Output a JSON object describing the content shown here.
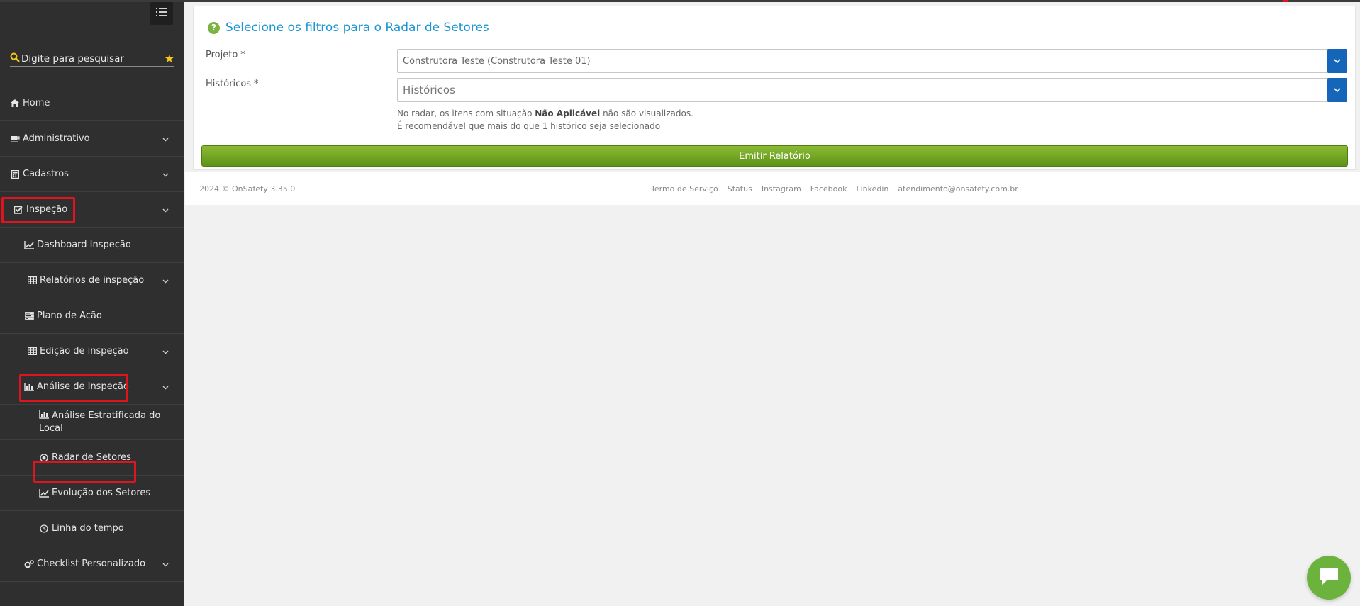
{
  "sidebar": {
    "search_placeholder": "Digite para pesquisar",
    "items": [
      {
        "label": "Home",
        "icon": "home-icon"
      },
      {
        "label": "Administrativo",
        "icon": "coffee-icon"
      },
      {
        "label": "Cadastros",
        "icon": "calculator-icon"
      },
      {
        "label": "Inspeção",
        "icon": "checkbox-icon"
      },
      {
        "label": "Dashboard Inspeção",
        "icon": "line-chart-icon"
      },
      {
        "label": "Relatórios de inspeção",
        "icon": "table-icon"
      },
      {
        "label": "Plano de Ação",
        "icon": "tasks-icon"
      },
      {
        "label": "Edição de inspeção",
        "icon": "table-icon"
      },
      {
        "label": "Análise de Inspeção",
        "icon": "bar-chart-icon"
      },
      {
        "label": "Análise Estratificada do Local",
        "icon": "bar-chart-icon"
      },
      {
        "label": "Radar de Setores",
        "icon": "dot-circle-icon"
      },
      {
        "label": "Evolução dos Setores",
        "icon": "line-chart-icon"
      },
      {
        "label": "Linha do tempo",
        "icon": "clock-icon"
      },
      {
        "label": "Checklist Personalizado",
        "icon": "cogs-icon"
      }
    ]
  },
  "panel": {
    "title": "Selecione os filtros para o Radar de Setores",
    "projeto_label": "Projeto",
    "historicos_label": "Históricos",
    "required_mark": "*",
    "projeto_value": "Construtora Teste (Construtora Teste 01)",
    "historicos_placeholder": "Históricos",
    "hint_prefix": "No radar, os itens com situação",
    "hint_bold": "Não Aplicável",
    "hint_suffix": "não são visualizados.",
    "hint_line2": "É recomendável que mais do que 1 histórico seja selecionado",
    "emit_button": "Emitir Relatório"
  },
  "footer": {
    "copyright": "2024 © OnSafety 3.35.0",
    "links": [
      "Termo de Serviço",
      "Status",
      "Instagram",
      "Facebook",
      "Linkedin",
      "atendimento@onsafety.com.br"
    ]
  },
  "colors": {
    "sidebar_bg": "#2f2f2f",
    "title_blue": "#1b95d3",
    "caret_blue": "#1565b8",
    "button_green": "#6e9f22",
    "highlight_red": "#e0141e",
    "chat_green": "#6cb33e"
  }
}
